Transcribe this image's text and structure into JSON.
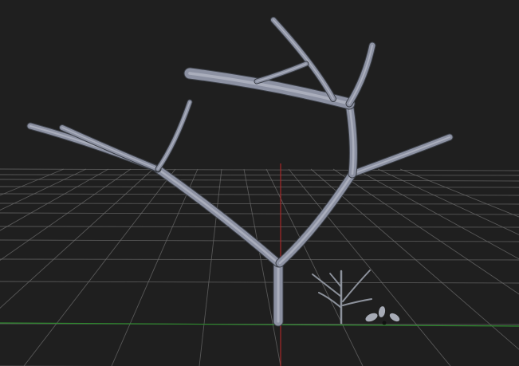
{
  "viewport": {
    "name": "3D Viewport",
    "background_color": "#1f1f1f",
    "grid_color": "#6a6a6a",
    "x_axis_color": "#2f8a2f",
    "y_axis_color": "#b22a2a"
  },
  "model": {
    "name": "tree-model",
    "branch_color": "#8c91a2",
    "branch_shadow_color": "#3c4048",
    "leaf_color": "#a7abb6"
  },
  "preview": {
    "name": "sapling-preview",
    "twig_color": "#8d929c"
  }
}
